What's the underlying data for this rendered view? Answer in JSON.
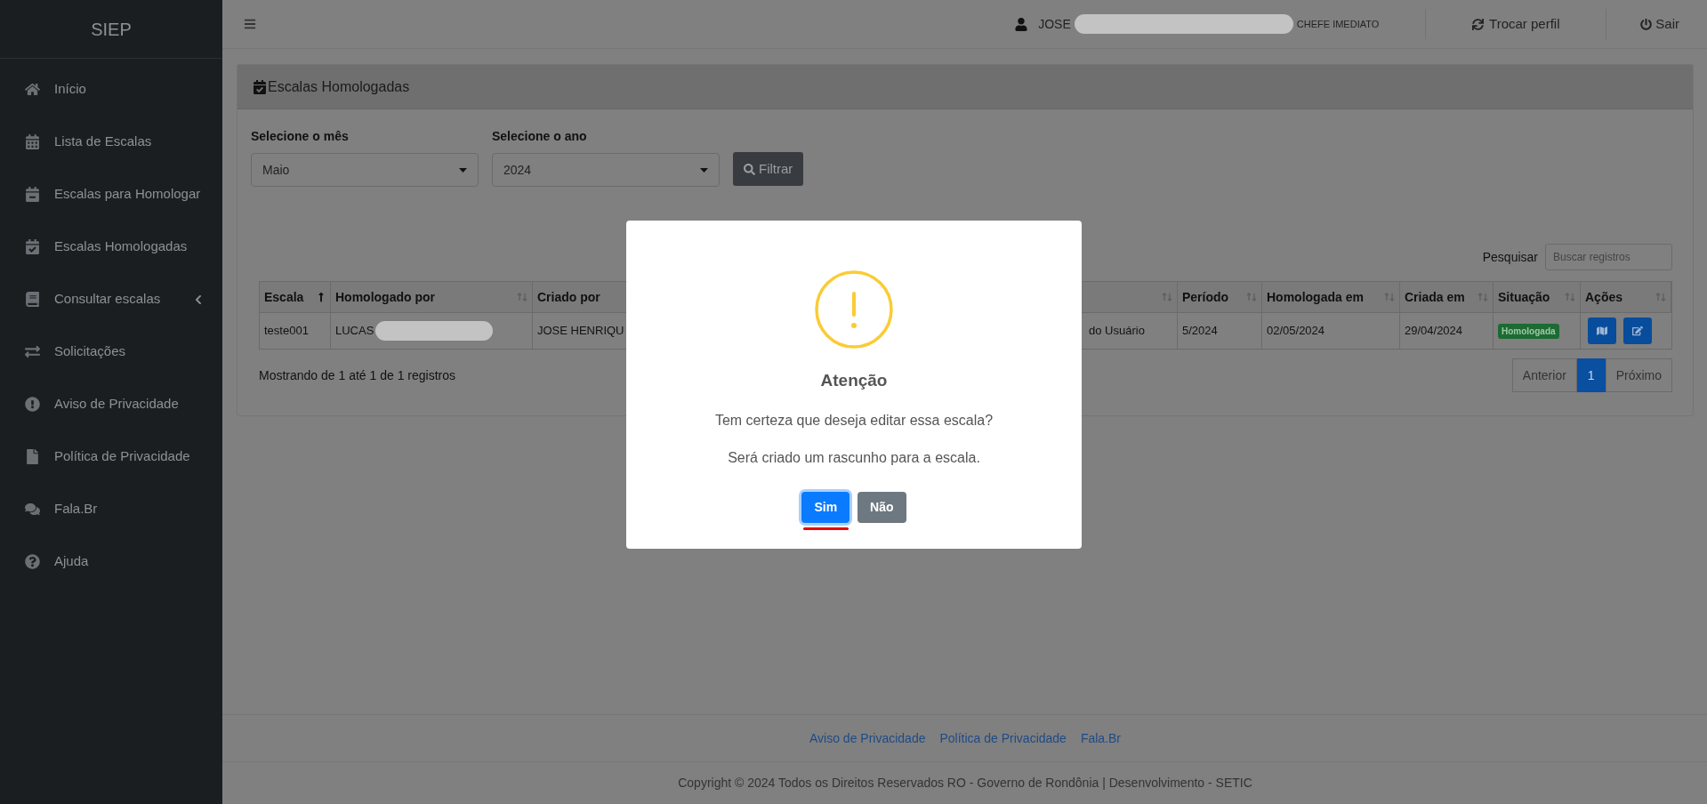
{
  "sidebar": {
    "brand": "SIEP",
    "items": [
      {
        "label": "Início",
        "kind": "link"
      },
      {
        "label": "Lista de Escalas",
        "kind": "link"
      },
      {
        "label": "Escalas para Homologar",
        "kind": "link"
      },
      {
        "label": "Escalas Homologadas",
        "kind": "link"
      },
      {
        "label": "Consultar escalas",
        "kind": "group",
        "expanded": false
      },
      {
        "label": "Solicitações",
        "kind": "link"
      },
      {
        "label": "Aviso de Privacidade",
        "kind": "link"
      },
      {
        "label": "Política de Privacidade",
        "kind": "link"
      },
      {
        "label": "Fala.Br",
        "kind": "link"
      },
      {
        "label": "Ajuda",
        "kind": "link"
      }
    ]
  },
  "topbar": {
    "user": {
      "name": "JOSE",
      "role": "CHEFE IMEDIATO"
    },
    "actions": [
      "Trocar perfil",
      "Sair"
    ]
  },
  "card": {
    "title": "Escalas Homologadas",
    "filters": [
      {
        "label": "Selecione o mês",
        "value": "Maio"
      },
      {
        "label": "Selecione o ano",
        "value": "2024"
      }
    ],
    "filter_button": "Filtrar",
    "search": {
      "label": "Pesquisar",
      "placeholder": "Buscar registros"
    },
    "table": {
      "columns": [
        {
          "label": "Escala",
          "sorted": true
        },
        {
          "label": "Homologado por",
          "sorted": false
        },
        {
          "label": "Criado por"
        },
        {
          "sorted": false
        },
        {
          "label": "Período",
          "sorted": false
        },
        {
          "label": "Homologada em",
          "sorted": false
        },
        {
          "label": "Criada em",
          "sorted": false
        },
        {
          "label": "Situação",
          "sorted": false
        },
        {
          "label": "Ações",
          "sorted": false
        }
      ],
      "rows": [
        {
          "escala": "teste001",
          "homologado_por": "LUCAS",
          "criado_por": "JOSE HENRIQU",
          "column_4": "do Usuário",
          "periodo": "5/2024",
          "homologada_em": "02/05/2024",
          "criada_em": "29/04/2024",
          "situacao": "Homologada"
        }
      ]
    },
    "info": "Mostrando de 1 até 1 de 1 registros",
    "pagination": [
      {
        "label": "Anterior",
        "selected": false
      },
      {
        "label": "1",
        "selected": true
      },
      {
        "label": "Próximo",
        "selected": false
      }
    ]
  },
  "footer": {
    "links": [
      "Aviso de Privacidade",
      "Política de Privacidade",
      "Fala.Br"
    ],
    "copyright": "Copyright © 2024 Todos os Direitos Reservados RO - Governo de Rondônia | Desenvolvimento - SETIC"
  },
  "dialog": {
    "title": "Atenção",
    "messages": [
      "Tem certeza que deseja editar essa escala?",
      "Será criado um rascunho para a escala."
    ],
    "buttons": [
      {
        "label": "Sim",
        "kind": "confirm",
        "focused": true
      },
      {
        "label": "Não",
        "kind": "cancel",
        "focused": false
      }
    ]
  }
}
